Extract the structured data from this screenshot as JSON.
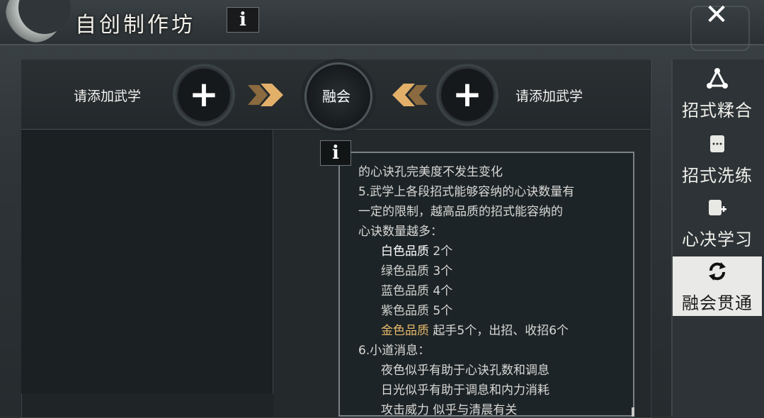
{
  "header": {
    "title": "自创制作坊",
    "info_label": "i",
    "close_label": "✕"
  },
  "fusion": {
    "left_slot_label": "请添加武学",
    "right_slot_label": "请添加武学",
    "plus_label": "+",
    "center_label": "融会",
    "arrow_color": "#e3b06a"
  },
  "nav": {
    "items": [
      {
        "label": "招式糅合",
        "icon": "triangle-nodes-icon"
      },
      {
        "label": "招式洗练",
        "icon": "scroll-icon"
      },
      {
        "label": "心决学习",
        "icon": "scroll-plus-icon"
      },
      {
        "label": "融会贯通",
        "icon": "refresh-icon",
        "active": true
      }
    ]
  },
  "tooltip": {
    "info_label": "i",
    "line1": "的心诀孔完美度不发生变化",
    "line2": "5.武学上各段招式能够容纳的心诀数量有",
    "line3": "一定的限制，越高品质的招式能容纳的",
    "line4": "心诀数量越多：",
    "qualities": [
      {
        "name": "白色品质",
        "value": "2个"
      },
      {
        "name": "绿色品质",
        "value": "3个"
      },
      {
        "name": "蓝色品质",
        "value": "4个"
      },
      {
        "name": "紫色品质",
        "value": "5个"
      },
      {
        "name": "金色品质",
        "value": "起手5个，出招、收招6个"
      }
    ],
    "line5": "6.小道消息：",
    "tips": [
      "夜色似乎有助于心诀孔数和调息",
      "日光似乎有助于调息和内力消耗",
      "攻击威力 似乎与清晨有关"
    ],
    "gold_color": "#e4b86a"
  }
}
